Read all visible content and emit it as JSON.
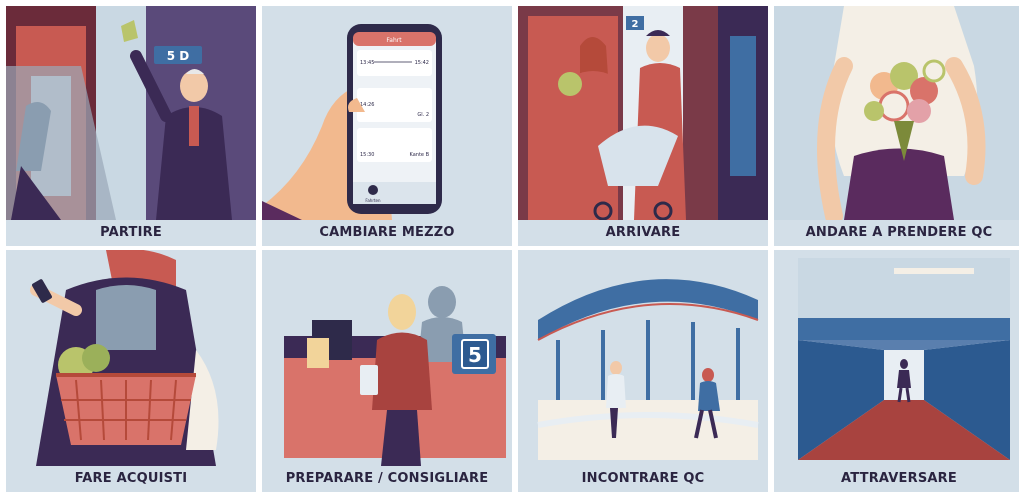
{
  "tiles": [
    {
      "id": "partire",
      "label": "PARTIRE"
    },
    {
      "id": "cambiare-mezzo",
      "label": "CAMBIARE MEZZO"
    },
    {
      "id": "arrivare",
      "label": "ARRIVARE"
    },
    {
      "id": "andare-a-prendere",
      "label": "ANDARE A PRENDERE QC"
    },
    {
      "id": "fare-acquisti",
      "label": "FARE ACQUISTI"
    },
    {
      "id": "preparare",
      "label": "PREPARARE / CONSIGLIARE"
    },
    {
      "id": "incontrare",
      "label": "INCONTRARE QC"
    },
    {
      "id": "attraversare",
      "label": "ATTRAVERSARE"
    }
  ],
  "art": {
    "platform_sign": "5 D",
    "counter_number": "5",
    "track_number": "2",
    "phone": {
      "header": "Fahrt",
      "time_from": "13:45",
      "time_to": "15:42",
      "row1_time": "14:26",
      "row1_platform": "Gl. 2",
      "row2_time": "15:30",
      "row2_platform": "Kante B",
      "nav_label": "Fahrten"
    }
  },
  "colors": {
    "tile_bg": "#d3dfe8",
    "label_text": "#2a2440",
    "accent_salmon": "#d9736a",
    "deep_purple": "#3b2a55",
    "steel_blue": "#3f6ea3"
  }
}
